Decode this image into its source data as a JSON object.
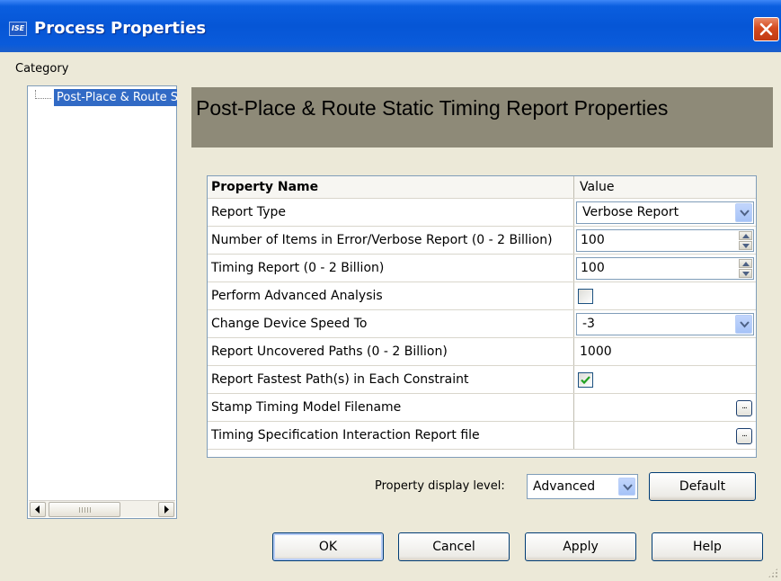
{
  "window": {
    "app_icon_text": "ISE",
    "title": "Process Properties"
  },
  "category": {
    "label": "Category",
    "tree_items": [
      "Post-Place & Route Static Timing"
    ]
  },
  "header": {
    "title": "Post-Place & Route Static Timing Report Properties"
  },
  "grid": {
    "columns": [
      "Property Name",
      "Value"
    ],
    "rows": [
      {
        "name": "Report Type",
        "value": "Verbose Report",
        "control": "dropdown"
      },
      {
        "name": "Number of Items in Error/Verbose Report (0 - 2 Billion)",
        "value": "100",
        "control": "spinner"
      },
      {
        "name": "Timing Report (0 - 2 Billion)",
        "value": "100",
        "control": "spinner"
      },
      {
        "name": "Perform Advanced Analysis",
        "value": "false",
        "control": "checkbox"
      },
      {
        "name": "Change Device Speed To",
        "value": "-3",
        "control": "dropdown"
      },
      {
        "name": "Report Uncovered Paths (0 - 2 Billion)",
        "value": "1000",
        "control": "text"
      },
      {
        "name": "Report Fastest Path(s) in Each Constraint",
        "value": "true",
        "control": "checkbox"
      },
      {
        "name": "Stamp Timing Model Filename",
        "value": "",
        "control": "browse"
      },
      {
        "name": "Timing Specification Interaction Report file",
        "value": "",
        "control": "browse"
      }
    ]
  },
  "display_level": {
    "label": "Property display level:",
    "value": "Advanced"
  },
  "buttons": {
    "default": "Default",
    "ok": "OK",
    "cancel": "Cancel",
    "apply": "Apply",
    "help": "Help"
  },
  "colors": {
    "title_bar": "#0656D6",
    "dialog_bg": "#ECE9D8",
    "header_band": "#8E8A78",
    "selection": "#316AC5",
    "close_button": "#D44A1E",
    "checkmark": "#21A121"
  }
}
